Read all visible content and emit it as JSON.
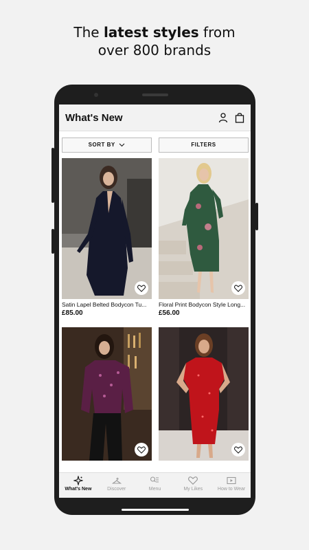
{
  "promo": {
    "line1_pre": "The ",
    "line1_bold": "latest styles",
    "line1_post": " from",
    "line2": "over 800 brands"
  },
  "header": {
    "title": "What's New",
    "icons": [
      "account-icon",
      "bag-icon"
    ]
  },
  "toolbar": {
    "sort_label": "SORT BY",
    "filters_label": "FILTERS"
  },
  "products": [
    {
      "name": "Satin Lapel Belted Bodycon Tu...",
      "price": "£85.00",
      "liked": false
    },
    {
      "name": "Floral Print Bodycon Style Long...",
      "price": "£56.00",
      "liked": false
    },
    {
      "name": "",
      "price": "",
      "liked": false
    },
    {
      "name": "",
      "price": "",
      "liked": false
    }
  ],
  "tabs": [
    {
      "label": "What's New",
      "icon": "sparkle-icon",
      "active": true
    },
    {
      "label": "Discover",
      "icon": "hanger-icon",
      "active": false
    },
    {
      "label": "Menu",
      "icon": "menu-search-icon",
      "active": false
    },
    {
      "label": "My Likes",
      "icon": "heart-icon",
      "active": false
    },
    {
      "label": "How to Wear",
      "icon": "play-icon",
      "active": false
    }
  ]
}
